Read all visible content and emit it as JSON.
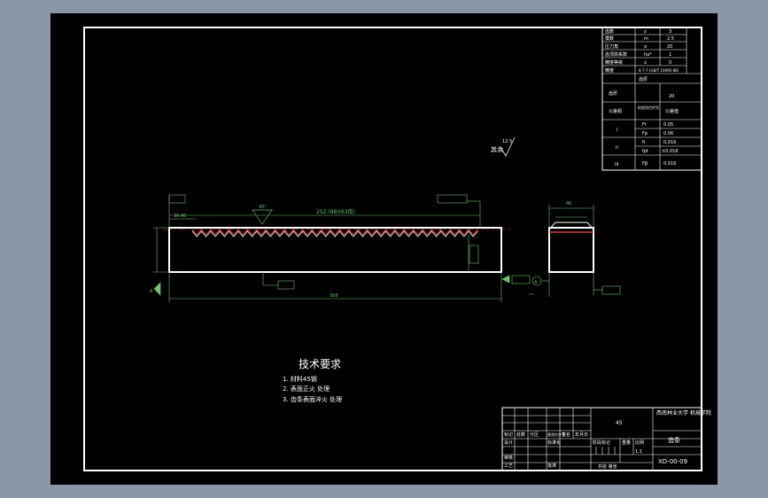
{
  "tech_requirements": {
    "title": "技术要求",
    "items": [
      "1. 材料45钢",
      "2. 表面正火 处理",
      "3. 齿条表面淬火 处理"
    ]
  },
  "roughness_note": {
    "value": "12.5",
    "label": "其余"
  },
  "dimensions": {
    "overall_length": "308",
    "pitch_length": "252.(88)(63齿)",
    "left_offset": "30.45",
    "angle": "45°",
    "side_width": "40",
    "datum": "A"
  },
  "param_table": {
    "rows": [
      [
        "齿数",
        "z",
        "3"
      ],
      [
        "模数",
        "m",
        "2.5"
      ],
      [
        "压力角",
        "α",
        "20"
      ],
      [
        "齿顶高系数",
        "ha*",
        "1"
      ],
      [
        "精度等级",
        "x",
        "0"
      ],
      [
        "精度",
        "8-7-7-(GB/T 10095-88)",
        ""
      ],
      [
        "齿厚",
        "齿厚",
        "20"
      ],
      [
        "公差组",
        "检验项目代号",
        "公差值"
      ],
      [
        "I",
        "Fr",
        "0.05"
      ],
      [
        "",
        "Fp",
        "0.06"
      ],
      [
        "II",
        "fi",
        "0.016"
      ],
      [
        "",
        "fpt",
        "±0.016"
      ],
      [
        "III",
        "Fβ",
        "0.016"
      ]
    ]
  },
  "title_block": {
    "material": "45",
    "school": "西南林业大学 机械学院",
    "part_name": "齿条",
    "drawing_no": "XD-00-09",
    "scale": "1:1",
    "weight_label": "重量",
    "scale_label": "比例",
    "stage_label": "阶段标记",
    "sheet_label": "共张 第张",
    "row_labels": [
      "标记",
      "设计",
      "审核",
      "工艺"
    ],
    "col_labels": [
      "处数",
      "分区",
      "更改文件号",
      "签名",
      "年月日"
    ],
    "std_label": "标准化",
    "approve_label": "批准"
  }
}
